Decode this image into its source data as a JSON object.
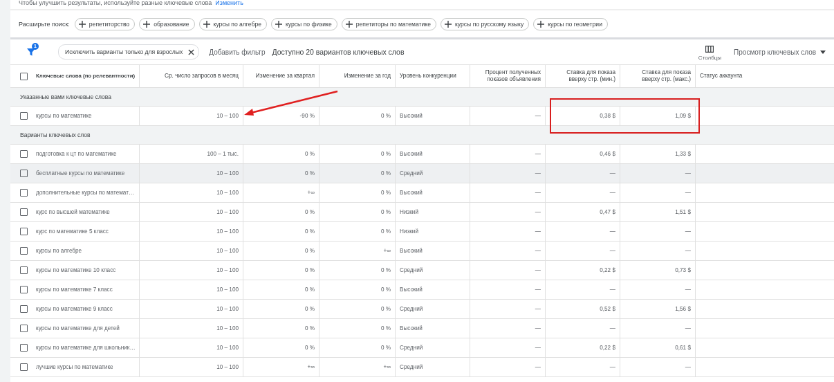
{
  "hint": {
    "text": "Чтобы улучшить результаты, используйте разные ключевые слова",
    "link": "Изменить"
  },
  "expand": {
    "label": "Расширьте поиск:",
    "chips": [
      "репетиторство",
      "образование",
      "курсы по алгебре",
      "курсы по физике",
      "репетиторы по математике",
      "курсы по русскому языку",
      "курсы по геометрии"
    ]
  },
  "toolbar": {
    "filter_count": "1",
    "filter_chip": "Исключить варианты только для взрослых",
    "add_filter": "Добавить фильтр",
    "summary": "Доступно 20 вариантов ключевых слов",
    "columns_button": "Столбцы",
    "view_menu": "Просмотр ключевых слов"
  },
  "table": {
    "header_checked": false,
    "columns": [
      "Ключевые слова (по релевантности)",
      "Ср. число запросов в месяц",
      "Изменение за квартал",
      "Изменение за год",
      "Уровень конкуренции",
      "Процент полученных показов объявления",
      "Ставка для показа вверху стр. (мин.)",
      "Ставка для показа вверху стр. (макс.)",
      "Статус аккаунта"
    ],
    "sections": [
      {
        "title": "Указанные вами ключевые слова",
        "rows": [
          {
            "checked": false,
            "hovered": false,
            "cells": [
              "курсы по математике",
              "10 – 100",
              "-90 %",
              "0 %",
              "Высокий",
              "—",
              "0,38 $",
              "1,09 $"
            ]
          }
        ]
      },
      {
        "title": "Варианты ключевых слов",
        "rows": [
          {
            "checked": false,
            "hovered": false,
            "cells": [
              "подготовка к цт по математике",
              "100 – 1 тыс.",
              "0 %",
              "0 %",
              "Высокий",
              "—",
              "0,46 $",
              "1,33 $"
            ]
          },
          {
            "checked": false,
            "hovered": true,
            "cells": [
              "бесплатные курсы по математике",
              "10 – 100",
              "0 %",
              "0 %",
              "Средний",
              "—",
              "—",
              "—"
            ]
          },
          {
            "checked": false,
            "hovered": false,
            "cells": [
              "дополнительные курсы по математ…",
              "10 – 100",
              "+∞",
              "0 %",
              "Высокий",
              "—",
              "—",
              "—"
            ]
          },
          {
            "checked": false,
            "hovered": false,
            "cells": [
              "курс по высшей математике",
              "10 – 100",
              "0 %",
              "0 %",
              "Низкий",
              "—",
              "0,47 $",
              "1,51 $"
            ]
          },
          {
            "checked": false,
            "hovered": false,
            "cells": [
              "курс по математике 5 класс",
              "10 – 100",
              "0 %",
              "0 %",
              "Низкий",
              "—",
              "—",
              "—"
            ]
          },
          {
            "checked": false,
            "hovered": false,
            "cells": [
              "курсы по алгебре",
              "10 – 100",
              "0 %",
              "+∞",
              "Высокий",
              "—",
              "—",
              "—"
            ]
          },
          {
            "checked": false,
            "hovered": false,
            "cells": [
              "курсы по математике 10 класс",
              "10 – 100",
              "0 %",
              "0 %",
              "Средний",
              "—",
              "0,22 $",
              "0,73 $"
            ]
          },
          {
            "checked": false,
            "hovered": false,
            "cells": [
              "курсы по математике 7 класс",
              "10 – 100",
              "0 %",
              "0 %",
              "Высокий",
              "—",
              "—",
              "—"
            ]
          },
          {
            "checked": false,
            "hovered": false,
            "cells": [
              "курсы по математике 9 класс",
              "10 – 100",
              "0 %",
              "0 %",
              "Средний",
              "—",
              "0,52 $",
              "1,56 $"
            ]
          },
          {
            "checked": false,
            "hovered": false,
            "cells": [
              "курсы по математике для детей",
              "10 – 100",
              "0 %",
              "0 %",
              "Высокий",
              "—",
              "—",
              "—"
            ]
          },
          {
            "checked": false,
            "hovered": false,
            "cells": [
              "курсы по математике для школьник…",
              "10 – 100",
              "0 %",
              "0 %",
              "Средний",
              "—",
              "0,22 $",
              "0,61 $"
            ]
          },
          {
            "checked": false,
            "hovered": false,
            "cells": [
              "лучшие курсы по математике",
              "10 – 100",
              "+∞",
              "+∞",
              "Средний",
              "—",
              "—",
              "—"
            ]
          }
        ]
      }
    ]
  }
}
